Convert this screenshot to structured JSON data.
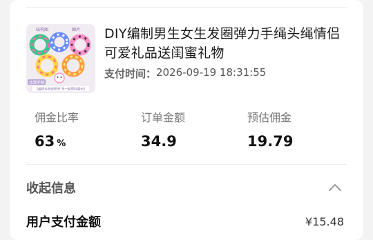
{
  "order": {
    "title": "DIY编制男生女生发圈弹力手绳头绳情侣可爱礼品送闺蜜礼物",
    "pay_time_label": "支付时间：",
    "pay_time_value": "2026-09-19 18:31:55",
    "thumbnail": {
      "caption_left": "动漫手链",
      "caption_top_left": "结构图",
      "caption_top_right": "图片",
      "banner": "【编织手链说明书 含一套原料展示】"
    }
  },
  "stats": [
    {
      "label": "佣金比率",
      "value": "63",
      "unit": "%"
    },
    {
      "label": "订单金额",
      "value": "34.9",
      "unit": ""
    },
    {
      "label": "预估佣金",
      "value": "19.79",
      "unit": ""
    }
  ],
  "collapse": {
    "label": "收起信息",
    "icon": "chevron-up-icon"
  },
  "payment": {
    "label": "用户支付金额",
    "amount": "¥15.48"
  }
}
